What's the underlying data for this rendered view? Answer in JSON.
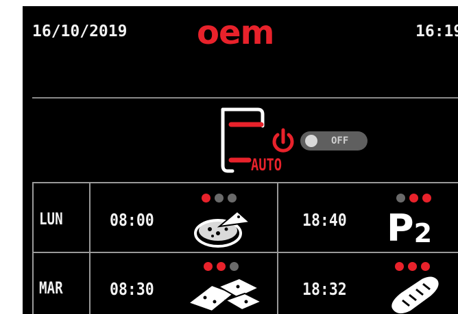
{
  "header": {
    "date": "16/10/2019",
    "time": "16:19",
    "logo": "oem"
  },
  "auto_mode": {
    "label": "AUTO",
    "icon": "auto-power-icon",
    "toggle": {
      "state_label": "OFF"
    }
  },
  "schedule": [
    {
      "day": "LUN",
      "morning": {
        "time": "08:00",
        "level": 1,
        "dots": [
          "#e8222b",
          "#6a6a6a",
          "#6a6a6a"
        ],
        "icon": "pizza-icon"
      },
      "evening": {
        "time": "18:40",
        "level": 2,
        "dots": [
          "#6a6a6a",
          "#e8222b",
          "#e8222b"
        ],
        "program": "P",
        "program_number": "2"
      }
    },
    {
      "day": "MAR",
      "morning": {
        "time": "08:30",
        "level": 2,
        "dots": [
          "#e8222b",
          "#e8222b",
          "#6a6a6a"
        ],
        "icon": "pizza-slices-icon"
      },
      "evening": {
        "time": "18:32",
        "level": 3,
        "dots": [
          "#e8222b",
          "#e8222b",
          "#e8222b"
        ],
        "icon": "bread-icon"
      }
    }
  ],
  "colors": {
    "accent": "#e8222b",
    "inactive_dot": "#6a6a6a",
    "background": "#000000",
    "text": "#f2f2f2"
  }
}
